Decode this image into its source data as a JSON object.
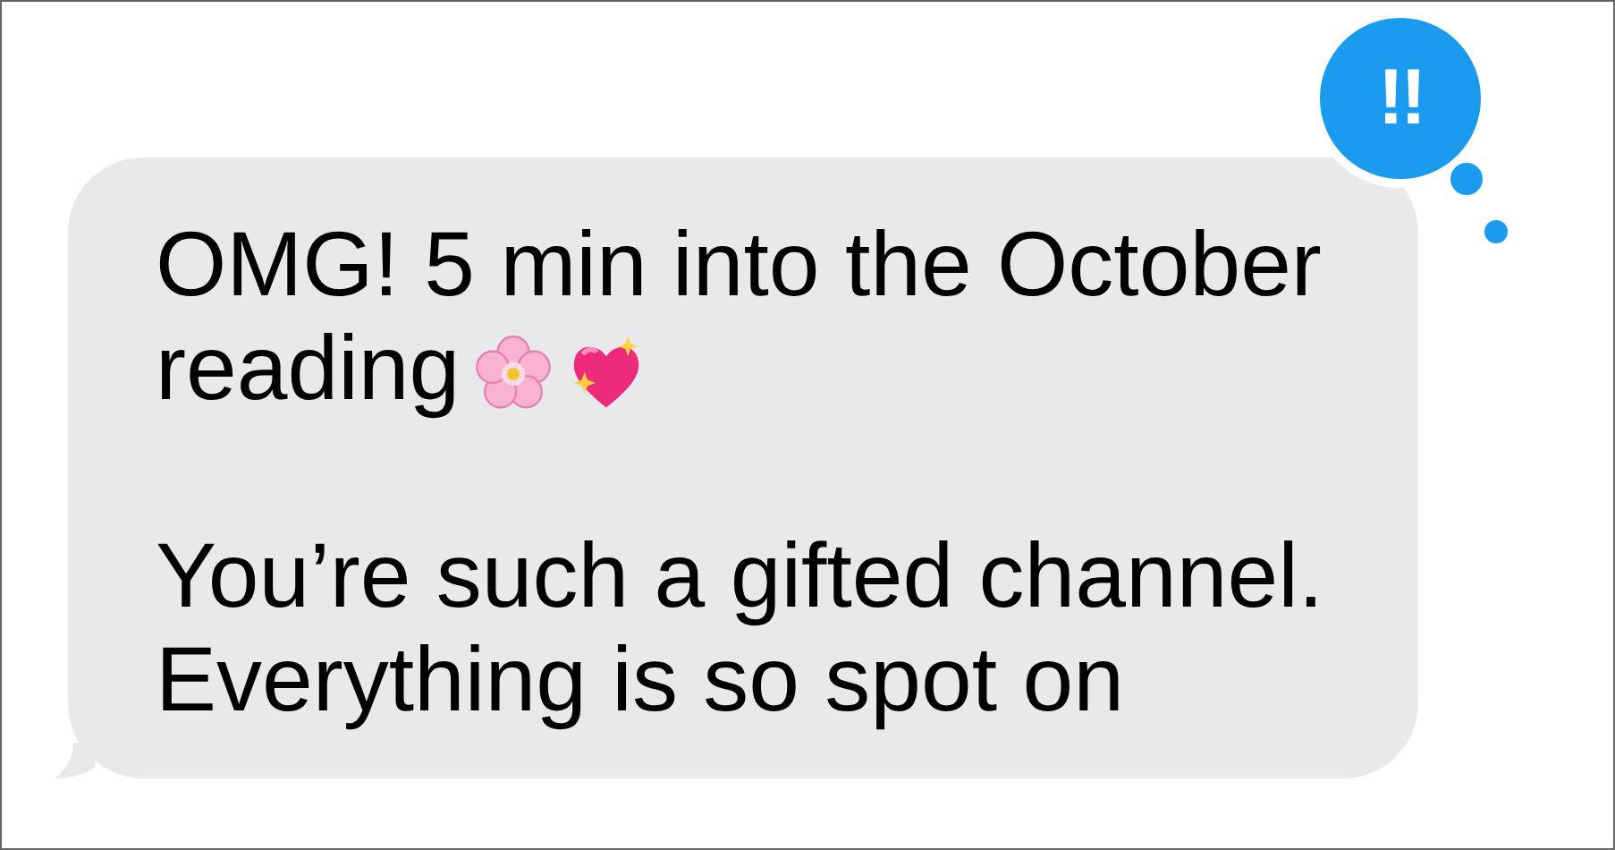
{
  "message": {
    "paragraphs": [
      {
        "lines": [
          "OMG! 5 min into the October",
          "reading"
        ]
      },
      {
        "lines": [
          "You’re such a gifted channel.",
          "Everything is so spot on"
        ]
      }
    ]
  },
  "tapback": {
    "symbol": "!!"
  }
}
